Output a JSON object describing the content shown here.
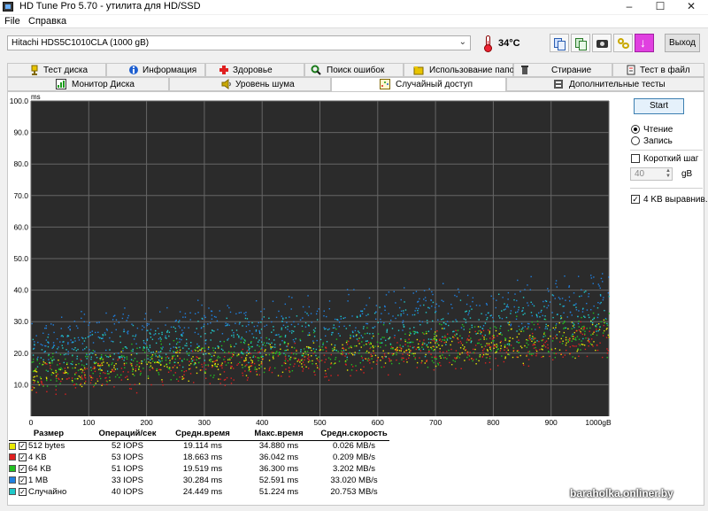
{
  "window": {
    "title": "HD Tune Pro 5.70 - утилита для HD/SSD"
  },
  "menu": [
    "File",
    "Справка"
  ],
  "toolbar": {
    "drive": "Hitachi HDS5C1010CLA (1000 gB)",
    "temperature": "34°C",
    "exit_label": "Выход"
  },
  "tabs_row1": [
    "Тест диска",
    "Информация",
    "Здоровье",
    "Поиск ошибок",
    "Использование папок",
    "Стирание",
    "Тест в файл"
  ],
  "tabs_row2": [
    "Монитор Диска",
    "Уровень шума",
    "Случайный доступ",
    "Дополнительные тесты"
  ],
  "active_tab": "Случайный доступ",
  "panel": {
    "start_label": "Start",
    "read_label": "Чтение",
    "write_label": "Запись",
    "short_step_label": "Короткий шаг",
    "short_step_value": "40",
    "short_step_unit": "gB",
    "align_label": "4 KB выравнив.",
    "mode": "read",
    "short_step_checked": false,
    "align_checked": true
  },
  "chart_data": {
    "type": "scatter",
    "ylabel": "ms",
    "xlabel": "gB",
    "xlim": [
      0,
      1000
    ],
    "ylim": [
      0,
      100
    ],
    "x_ticks": [
      "0",
      "100",
      "200",
      "300",
      "400",
      "500",
      "600",
      "700",
      "800",
      "900",
      "1000gB"
    ],
    "y_ticks": [
      "100.0",
      "90.0",
      "80.0",
      "70.0",
      "60.0",
      "50.0",
      "40.0",
      "30.0",
      "20.0",
      "10.0"
    ],
    "grid": true,
    "series": [
      {
        "name": "512 bytes",
        "color": "#e8e800",
        "ms_range_start": [
          8,
          20
        ],
        "ms_range_end": [
          18,
          33
        ]
      },
      {
        "name": "4 KB",
        "color": "#e02020",
        "ms_range_start": [
          5,
          18
        ],
        "ms_range_end": [
          17,
          32
        ]
      },
      {
        "name": "64 KB",
        "color": "#20c020",
        "ms_range_start": [
          8,
          22
        ],
        "ms_range_end": [
          18,
          35
        ]
      },
      {
        "name": "1 MB",
        "color": "#2080e0",
        "ms_range_start": [
          16,
          33
        ],
        "ms_range_end": [
          28,
          48
        ]
      },
      {
        "name": "Случайно",
        "color": "#20c8c8",
        "ms_range_start": [
          12,
          28
        ],
        "ms_range_end": [
          22,
          42
        ]
      }
    ]
  },
  "table": {
    "headers": [
      "Размер",
      "Операций/сек",
      "Средн.время",
      "Макс.время",
      "Средн.скорость"
    ],
    "rows": [
      {
        "size": "512 bytes",
        "color": "#e8e800",
        "ops": "52 IOPS",
        "avg": "19.114 ms",
        "max": "34.880 ms",
        "speed": "0.026 MB/s"
      },
      {
        "size": "4 KB",
        "color": "#e02020",
        "ops": "53 IOPS",
        "avg": "18.663 ms",
        "max": "36.042 ms",
        "speed": "0.209 MB/s"
      },
      {
        "size": "64 KB",
        "color": "#20c020",
        "ops": "51 IOPS",
        "avg": "19.519 ms",
        "max": "36.300 ms",
        "speed": "3.202 MB/s"
      },
      {
        "size": "1 MB",
        "color": "#2080e0",
        "ops": "33 IOPS",
        "avg": "30.284 ms",
        "max": "52.591 ms",
        "speed": "33.020 MB/s"
      },
      {
        "size": "Случайно",
        "color": "#20c8c8",
        "ops": "40 IOPS",
        "avg": "24.449 ms",
        "max": "51.224 ms",
        "speed": "20.753 MB/s"
      }
    ]
  },
  "watermark": "baraholka.onliner.by"
}
